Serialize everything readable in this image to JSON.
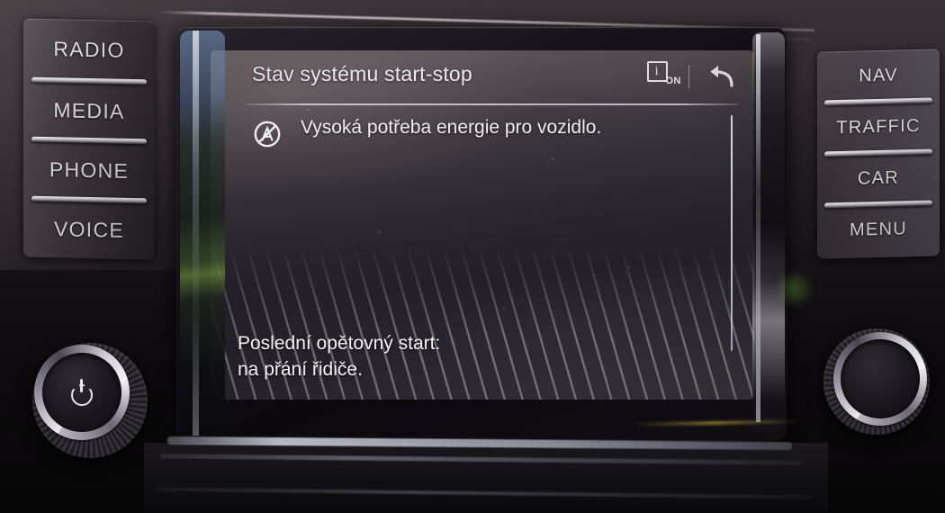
{
  "device": {
    "name": "car-infotainment-head-unit"
  },
  "left_buttons": [
    {
      "label": "RADIO",
      "icon": "radio-button"
    },
    {
      "label": "MEDIA",
      "icon": "media-button"
    },
    {
      "label": "PHONE",
      "icon": "phone-button"
    },
    {
      "label": "VOICE",
      "icon": "voice-button"
    }
  ],
  "right_buttons": [
    {
      "label": "NAV",
      "icon": "nav-button"
    },
    {
      "label": "TRAFFIC",
      "icon": "traffic-button"
    },
    {
      "label": "CAR",
      "icon": "car-button"
    },
    {
      "label": "MENU",
      "icon": "menu-button"
    }
  ],
  "knobs": {
    "left": {
      "icon": "power-icon",
      "name": "power-volume-knob"
    },
    "right": {
      "icon": "",
      "name": "tune-scroll-knob"
    }
  },
  "screen": {
    "header": {
      "title": "Stav systému start-stop",
      "info_icon": {
        "glyph": "i",
        "sub_label": "ON",
        "name": "info-on-icon"
      },
      "back_icon": {
        "name": "back-arrow-icon"
      }
    },
    "message": {
      "icon": "start-stop-disabled-icon",
      "text": "Vysoká potřeba energie pro vozidlo."
    },
    "footer": {
      "line1": "Poslední opětovný start:",
      "line2": "na přání řidiče."
    },
    "scrollbar": {
      "name": "vertical-scrollbar"
    }
  },
  "colors": {
    "screen_top": "#6e6569",
    "screen_bottom": "#2a2630",
    "text": "#f0eef2",
    "button_text": "#dcd9dd",
    "separator": "#d7d4dc"
  }
}
